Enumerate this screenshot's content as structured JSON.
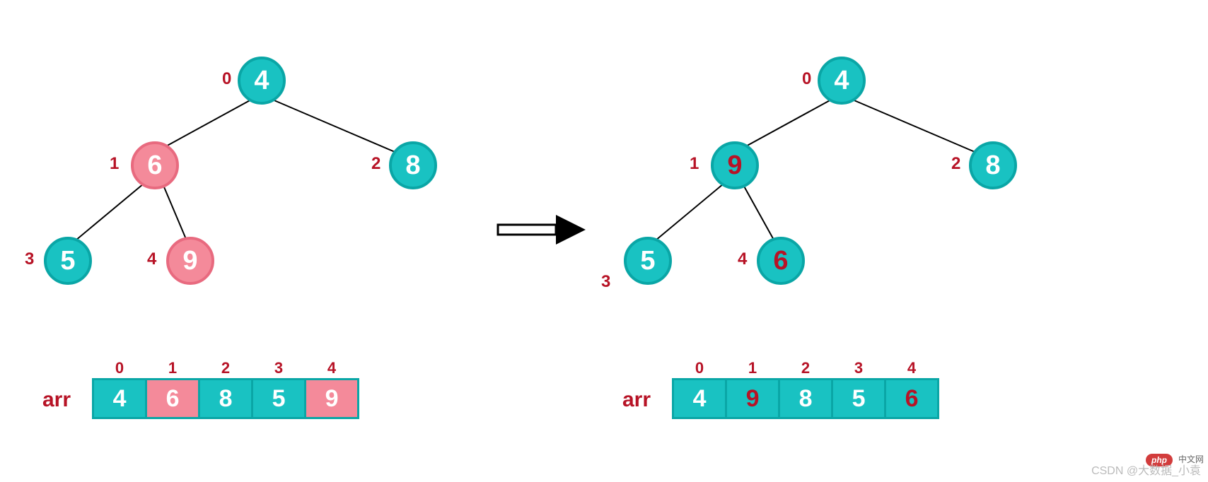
{
  "left": {
    "nodes": [
      {
        "idx": "0",
        "val": "4",
        "color": "teal"
      },
      {
        "idx": "1",
        "val": "6",
        "color": "pink"
      },
      {
        "idx": "2",
        "val": "8",
        "color": "teal"
      },
      {
        "idx": "3",
        "val": "5",
        "color": "teal"
      },
      {
        "idx": "4",
        "val": "9",
        "color": "pink"
      }
    ],
    "arr_label": "arr",
    "cells": [
      {
        "idx": "0",
        "val": "4",
        "color": "teal",
        "red": false
      },
      {
        "idx": "1",
        "val": "6",
        "color": "pink",
        "red": false
      },
      {
        "idx": "2",
        "val": "8",
        "color": "teal",
        "red": false
      },
      {
        "idx": "3",
        "val": "5",
        "color": "teal",
        "red": false
      },
      {
        "idx": "4",
        "val": "9",
        "color": "pink",
        "red": false
      }
    ]
  },
  "right": {
    "nodes": [
      {
        "idx": "0",
        "val": "4",
        "color": "teal",
        "red": false
      },
      {
        "idx": "1",
        "val": "9",
        "color": "teal",
        "red": true
      },
      {
        "idx": "2",
        "val": "8",
        "color": "teal",
        "red": false
      },
      {
        "idx": "3",
        "val": "5",
        "color": "teal",
        "red": false
      },
      {
        "idx": "4",
        "val": "6",
        "color": "teal",
        "red": true
      }
    ],
    "arr_label": "arr",
    "cells": [
      {
        "idx": "0",
        "val": "4",
        "color": "teal",
        "red": false
      },
      {
        "idx": "1",
        "val": "9",
        "color": "teal",
        "red": true
      },
      {
        "idx": "2",
        "val": "8",
        "color": "teal",
        "red": false
      },
      {
        "idx": "3",
        "val": "5",
        "color": "teal",
        "red": false
      },
      {
        "idx": "4",
        "val": "6",
        "color": "teal",
        "red": true
      }
    ]
  },
  "watermark": "CSDN @大数据_小袁",
  "php_badge": "php",
  "cn_net": "中文网",
  "chart_data": {
    "type": "diagram",
    "description": "Heap-sort heapify step: swap of node index 1 (value 6) with child index 4 (value 9) in a binary heap represented as array. Left side shows tree and array before swap (nodes 1 and 4 highlighted pink). Right side shows after swap (values 9 and 6 shown in red at positions 1 and 4).",
    "before": {
      "array": [
        4,
        6,
        8,
        5,
        9
      ],
      "highlight_indices": [
        1,
        4
      ]
    },
    "after": {
      "array": [
        4,
        9,
        8,
        5,
        6
      ],
      "changed_indices": [
        1,
        4
      ]
    },
    "tree_structure": {
      "parent_of": {
        "1": 0,
        "2": 0,
        "3": 1,
        "4": 1
      }
    }
  }
}
